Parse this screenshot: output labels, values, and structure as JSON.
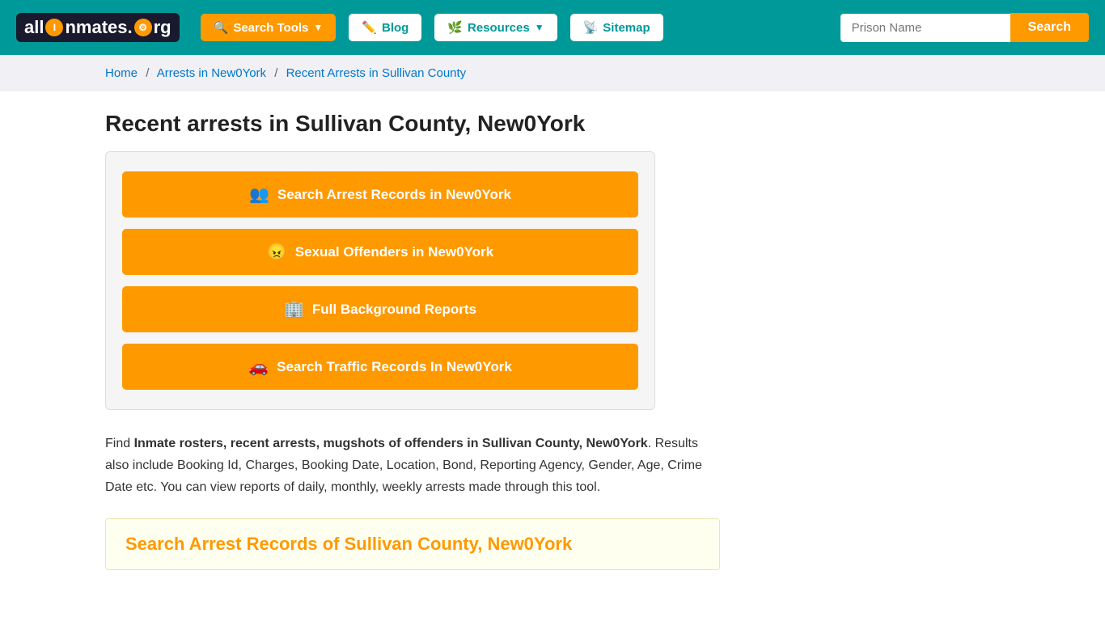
{
  "header": {
    "logo": "allinmates.org",
    "nav": [
      {
        "id": "search-tools",
        "label": "Search Tools",
        "icon": "🔍",
        "dropdown": true
      },
      {
        "id": "blog",
        "label": "Blog",
        "icon": "✏️",
        "dropdown": false
      },
      {
        "id": "resources",
        "label": "Resources",
        "icon": "🌿",
        "dropdown": true
      },
      {
        "id": "sitemap",
        "label": "Sitemap",
        "icon": "📡",
        "dropdown": false
      }
    ],
    "search_placeholder": "Prison Name",
    "search_button": "Search"
  },
  "breadcrumb": {
    "home": "Home",
    "arrests": "Arrests in New0York",
    "current": "Recent Arrests in Sullivan County"
  },
  "page": {
    "title": "Recent arrests in Sullivan County, New0York",
    "action_buttons": [
      {
        "id": "arrest-records",
        "icon": "👥",
        "label": "Search Arrest Records in New0York"
      },
      {
        "id": "sexual-offenders",
        "icon": "😠",
        "label": "Sexual Offenders in New0York"
      },
      {
        "id": "background-reports",
        "icon": "🏢",
        "label": "Full Background Reports"
      },
      {
        "id": "traffic-records",
        "icon": "🚗",
        "label": "Search Traffic Records In New0York"
      }
    ],
    "description_intro": "Find ",
    "description_bold": "Inmate rosters, recent arrests, mugshots of offenders in Sullivan County, New0York",
    "description_rest": ". Results also include Booking Id, Charges, Booking Date, Location, Bond, Reporting Agency, Gender, Age, Crime Date etc. You can view reports of daily, monthly, weekly arrests made through this tool.",
    "arrest_search_title": "Search Arrest Records of Sullivan County, New0York"
  }
}
